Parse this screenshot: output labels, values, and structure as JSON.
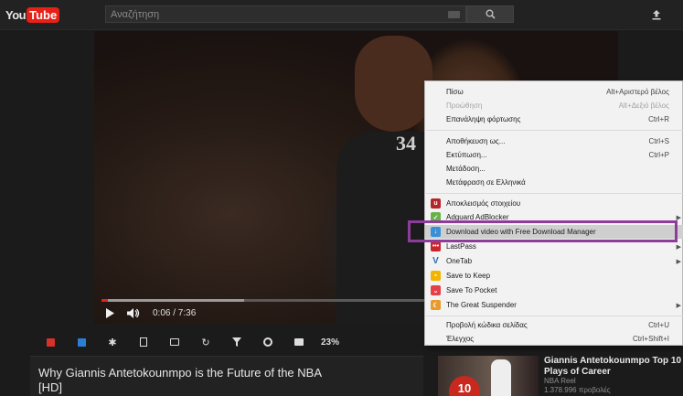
{
  "header": {
    "logo_you": "You",
    "logo_tube": "Tube",
    "search_placeholder": "Αναζήτηση"
  },
  "player": {
    "jersey_number": "34",
    "time": "0:06 / 7:36",
    "progress_played_fraction": 0.013,
    "progress_loaded_fraction": 0.28
  },
  "extension_bar": {
    "zoom": "23%"
  },
  "video": {
    "title": "Why Giannis Antetokounmpo is the Future of the NBA [HD]"
  },
  "related": {
    "title": "Giannis Antetokounmpo Top 10 Plays of Career",
    "channel": "NBA Reel",
    "views": "1.378.996 προβολές",
    "thumb_number": "10"
  },
  "context_menu": {
    "items": [
      {
        "label": "Πίσω",
        "shortcut": "Alt+Αριστερό βέλος",
        "disabled": false
      },
      {
        "label": "Προώθηση",
        "shortcut": "Alt+Δεξιό βέλος",
        "disabled": true
      },
      {
        "label": "Επανάληψη φόρτωσης",
        "shortcut": "Ctrl+R",
        "disabled": false
      },
      {
        "label": "Αποθήκευση ως...",
        "shortcut": "Ctrl+S",
        "disabled": false
      },
      {
        "label": "Εκτύπωση...",
        "shortcut": "Ctrl+P",
        "disabled": false
      },
      {
        "label": "Μετάδοση...",
        "shortcut": "",
        "disabled": false
      },
      {
        "label": "Μετάφραση σε Ελληνικά",
        "shortcut": "",
        "disabled": false
      },
      {
        "label": "Αποκλεισμός στοιχείου",
        "shortcut": "",
        "disabled": false
      },
      {
        "label": "Adguard AdBlocker",
        "shortcut": "",
        "disabled": false
      },
      {
        "label": "Download video with Free Download Manager",
        "shortcut": "",
        "disabled": false
      },
      {
        "label": "LastPass",
        "shortcut": "",
        "disabled": false
      },
      {
        "label": "OneTab",
        "shortcut": "",
        "disabled": false
      },
      {
        "label": "Save to Keep",
        "shortcut": "",
        "disabled": false
      },
      {
        "label": "Save To Pocket",
        "shortcut": "",
        "disabled": false
      },
      {
        "label": "The Great Suspender",
        "shortcut": "",
        "disabled": false
      },
      {
        "label": "Προβολή κώδικα σελίδας",
        "shortcut": "Ctrl+U",
        "disabled": false
      },
      {
        "label": "Έλεγχος",
        "shortcut": "Ctrl+Shift+I",
        "disabled": false
      }
    ]
  },
  "colors": {
    "accent": "#e62117",
    "highlight_border": "#8e3c9c",
    "menu_bg": "#f2f2f2"
  }
}
